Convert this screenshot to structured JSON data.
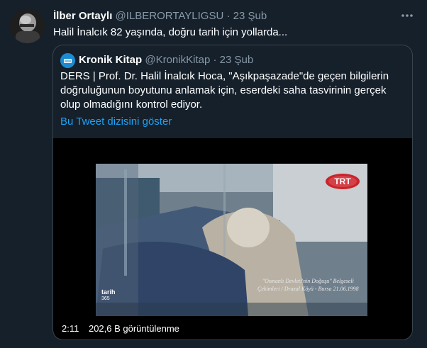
{
  "author": {
    "name": "İlber Ortaylı",
    "handle": "@ILBERORTAYLIGSU",
    "separator": "·",
    "date": "23 Şub",
    "more_icon": "more-horizontal-icon"
  },
  "tweet": {
    "text": "Halil İnalcık 82 yaşında, doğru tarih için yollarda..."
  },
  "quote": {
    "name": "Kronik Kitap",
    "handle": "@KronikKitap",
    "separator": "·",
    "date": "23 Şub",
    "text_lines": [
      "DERS | Prof. Dr. Halil İnalcık Hoca, \"Aşıkpaşazade\"de geçen bilgilerin",
      "doğruluğunun boyutunu anlamak için, eserdeki saha tasvirinin gerçek",
      "olup olmadığını kontrol ediyor."
    ],
    "thread_link": "Bu Tweet dizisini göster",
    "video": {
      "channel_logo": "TRT",
      "caption_line1": "\"Osmanlı Devleti'nin Doğuşu\" Belgeseli",
      "caption_line2": "Çekimleri / Drazal Köyü - Bursa 21.06.1998",
      "watermark": "tarih",
      "watermark_sub": "365",
      "duration": "2:11",
      "views": "202,6 B görüntülenme"
    }
  }
}
